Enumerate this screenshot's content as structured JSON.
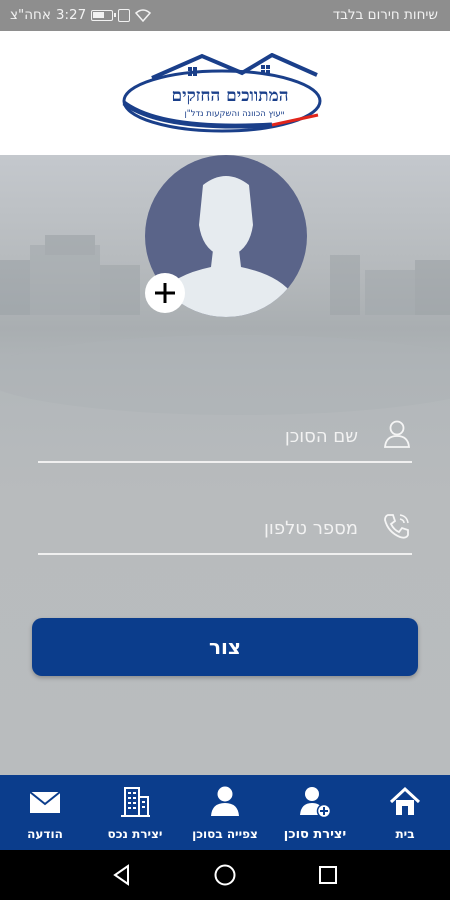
{
  "status_bar": {
    "carrier": "שיחות חירום בלבד",
    "time": "3:27",
    "period": "אחה\"צ"
  },
  "header": {
    "logo_title": "המתווכים החזקים",
    "logo_subtitle": "ייעוץ הכוונה והשקעות נדל\"ן",
    "logo_colors": {
      "blue": "#1a3f8a",
      "red": "#e1251b"
    }
  },
  "form": {
    "agent_name_placeholder": "שם הסוכן",
    "phone_placeholder": "מספר טלפון",
    "submit_label": "צור"
  },
  "bottom_nav": {
    "items": [
      {
        "label": "בית",
        "icon": "home-icon"
      },
      {
        "label": "יצירת סוכן",
        "icon": "add-agent-icon",
        "active": true
      },
      {
        "label": "צפייה בסוכן",
        "icon": "person-icon"
      },
      {
        "label": "יצירת נכס",
        "icon": "building-icon"
      },
      {
        "label": "הודעה",
        "icon": "mail-icon"
      }
    ]
  },
  "colors": {
    "primary": "#0b3d8c",
    "avatar_bg": "#5a6489",
    "status_bar": "#8e8e8e"
  }
}
